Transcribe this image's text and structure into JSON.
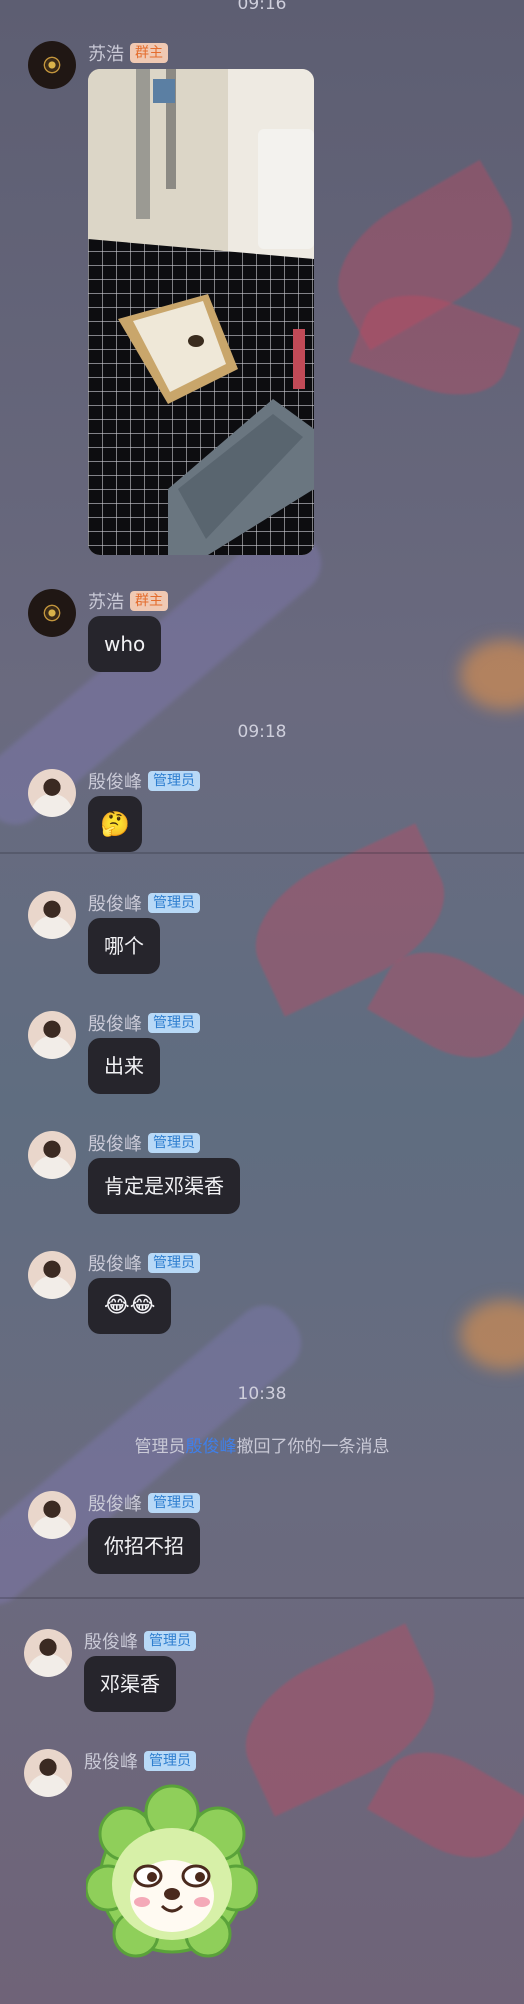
{
  "messages": [
    {
      "type": "time",
      "text": "09:16"
    },
    {
      "type": "image",
      "sender": "苏浩",
      "badge": "群主",
      "image_label": "照片：卫生间蹲便器"
    },
    {
      "type": "text",
      "sender": "苏浩",
      "badge": "群主",
      "text": "who"
    },
    {
      "type": "time",
      "text": "09:18"
    },
    {
      "type": "emoji",
      "sender": "殷俊峰",
      "badge": "管理员",
      "text": "🤔"
    },
    {
      "type": "text",
      "sender": "殷俊峰",
      "badge": "管理员",
      "text": "哪个"
    },
    {
      "type": "text",
      "sender": "殷俊峰",
      "badge": "管理员",
      "text": "出来"
    },
    {
      "type": "text",
      "sender": "殷俊峰",
      "badge": "管理员",
      "text": "肯定是邓渠香"
    },
    {
      "type": "text",
      "sender": "殷俊峰",
      "badge": "管理员",
      "text": "😂😂"
    },
    {
      "type": "time",
      "text": "10:38"
    },
    {
      "type": "notice",
      "prefix": "管理员",
      "who": "殷俊峰",
      "suffix": "撤回了你的一条消息"
    },
    {
      "type": "text",
      "sender": "殷俊峰",
      "badge": "管理员",
      "text": "你招不招"
    },
    {
      "type": "text",
      "sender": "殷俊峰",
      "badge": "管理员",
      "text": "邓渠香"
    },
    {
      "type": "sticker",
      "sender": "殷俊峰",
      "badge": "管理员",
      "sticker": "cabbage-dog-sticker"
    }
  ],
  "colors": {
    "owner_badge": "#e46d2e",
    "admin_badge": "#2f7fd0",
    "recall_name": "#3f7fe8",
    "bubble": "#26252c"
  }
}
